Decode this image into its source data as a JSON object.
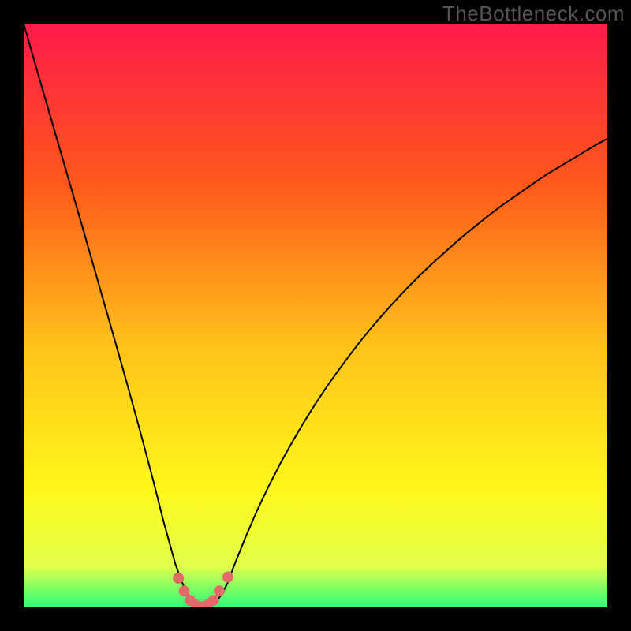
{
  "watermark": "TheBottleneck.com",
  "colors": {
    "top": "#ff1a4a",
    "mid_upper": "#ff6a1a",
    "mid": "#ffc21a",
    "mid_lower": "#fff81a",
    "bottom": "#2aff7a",
    "curve": "#000000",
    "marker": "#e46a6a",
    "background": "#000000"
  },
  "chart_data": {
    "type": "line",
    "title": "",
    "xlabel": "",
    "ylabel": "",
    "xlim": [
      0,
      100
    ],
    "ylim": [
      0,
      100
    ],
    "x": [
      0,
      2,
      4,
      6,
      8,
      10,
      12,
      14,
      16,
      18,
      20,
      22,
      24,
      26,
      27,
      28,
      29,
      30,
      31,
      32,
      33,
      34,
      35,
      36,
      38,
      40,
      42,
      44,
      46,
      48,
      50,
      52,
      54,
      56,
      58,
      60,
      62,
      64,
      66,
      68,
      70,
      72,
      74,
      76,
      78,
      80,
      82,
      84,
      86,
      88,
      90,
      92,
      94,
      96,
      98,
      100
    ],
    "y": [
      100,
      93.0,
      86.1,
      79.2,
      72.3,
      65.4,
      58.4,
      51.4,
      44.4,
      37.3,
      30.0,
      22.5,
      14.6,
      7.4,
      4.6,
      2.4,
      1.0,
      0.3,
      0.0,
      0.3,
      1.0,
      2.3,
      4.3,
      7.0,
      12.0,
      16.6,
      20.8,
      24.7,
      28.3,
      31.7,
      34.9,
      37.9,
      40.7,
      43.4,
      46.0,
      48.4,
      50.7,
      52.9,
      55.0,
      57.0,
      58.9,
      60.7,
      62.5,
      64.2,
      65.8,
      67.4,
      68.9,
      70.3,
      71.7,
      73.1,
      74.4,
      75.6,
      76.8,
      78.0,
      79.2,
      80.3
    ],
    "markers": {
      "x": [
        26.5,
        27.5,
        28.5,
        29.5,
        30.5,
        31.5,
        32.5,
        33.5,
        35.0
      ],
      "y": [
        5.0,
        2.8,
        1.2,
        0.4,
        0.1,
        0.4,
        1.2,
        2.8,
        5.2
      ]
    },
    "gradient_stops": [
      {
        "offset": 0.0,
        "color": "#ff1a4a"
      },
      {
        "offset": 0.28,
        "color": "#ff5a1a"
      },
      {
        "offset": 0.55,
        "color": "#ffc21a"
      },
      {
        "offset": 0.8,
        "color": "#fff81a"
      },
      {
        "offset": 0.93,
        "color": "#e0ff4a"
      },
      {
        "offset": 1.0,
        "color": "#2aff7a"
      }
    ]
  }
}
